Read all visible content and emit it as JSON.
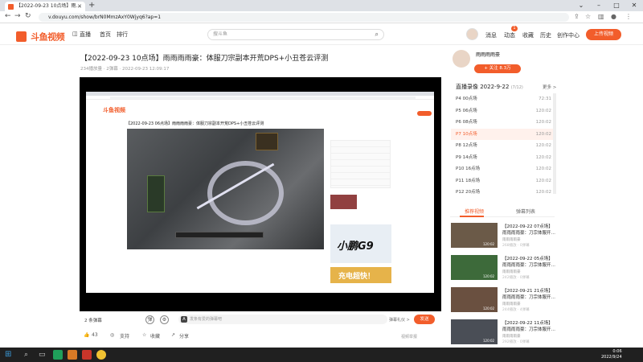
{
  "browser": {
    "tab_title": "【2022-09-23 10点场】雨…",
    "url": "v.douyu.com/show/brN0MmzAxY0Wjyq6?ap=1",
    "new_tab": "+"
  },
  "site": {
    "logo": "斗鱼视频",
    "nav": [
      "直播",
      "首页",
      "排行"
    ],
    "search_placeholder": "搜斗鱼",
    "user_links": [
      "消息",
      "动态",
      "收藏",
      "历史",
      "创作中心"
    ],
    "dynamic_badge": "1",
    "upload_label": "上传视频"
  },
  "video": {
    "title": "【2022-09-23 10点场】雨雨雨雨豪：体服刀宗副本开荒DPS+小丑苍云评测",
    "meta": "234播放量 · 2弹幕 · 2022-09-23 12:09:17",
    "danmu_count": "2 条弹幕",
    "danmu_placeholder": "发条有爱的弹幕吧",
    "danmu_settings": "弹幕礼仪 >",
    "send_label": "发送",
    "like_count": "43",
    "support_label": "支持",
    "collect_label": "收藏",
    "share_label": "分享",
    "report_label": "视频举报",
    "inner_logo": "斗鱼视频",
    "inner_title": "【2022-09-23 06点场】雨雨雨雨豪：体服刀宗副本开荒DPS+小丑苍云评测",
    "inner_ad_text": "小鹏G9",
    "inner_banner_text": "充电超快！"
  },
  "sidebar": {
    "author": "雨雨雨雨豪",
    "follow_label": "+ 关注 8.3万",
    "record_title": "直播录像 2022-9-22",
    "record_count": "7/12",
    "record_more": "更多 >",
    "records": [
      {
        "label": "P4 00点场",
        "dur": "72:31",
        "active": false
      },
      {
        "label": "P5 06点场",
        "dur": "120:02",
        "active": false
      },
      {
        "label": "P6 08点场",
        "dur": "120:02",
        "active": false
      },
      {
        "label": "P7 10点场",
        "dur": "120:02",
        "active": true
      },
      {
        "label": "P8 12点场",
        "dur": "120:02",
        "active": false
      },
      {
        "label": "P9 14点场",
        "dur": "120:02",
        "active": false
      },
      {
        "label": "P10 16点场",
        "dur": "120:02",
        "active": false
      },
      {
        "label": "P11 18点场",
        "dur": "120:02",
        "active": false
      },
      {
        "label": "P12 20点场",
        "dur": "120:02",
        "active": false
      }
    ],
    "tab_recommend": "推荐视频",
    "tab_danmu": "弹幕列表",
    "related": [
      {
        "title": "【2022-09-22 07点场】雨雨雨雨豪：刀宗体服开…",
        "author": "雨雨雨雨豪",
        "stats": "268播放 · 0弹幕",
        "dur": "120:02",
        "color": "#6b5a48"
      },
      {
        "title": "【2022-09-22 05点场】雨雨雨雨豪：刀宗体服开…",
        "author": "雨雨雨雨豪",
        "stats": "242播放 · 0弹幕",
        "dur": "120:02",
        "color": "#3d6a3a"
      },
      {
        "title": "【2022-09-21 21点场】雨雨雨雨豪：刀宗体服开…",
        "author": "雨雨雨雨豪",
        "stats": "244播放 · 4弹幕",
        "dur": "120:02",
        "color": "#6a5040"
      },
      {
        "title": "【2022-09-22 11点场】雨雨雨雨豪：刀宗体服开…",
        "author": "雨雨雨雨豪",
        "stats": "292播放 · 0弹幕",
        "dur": "120:02",
        "color": "#4a4e56"
      }
    ]
  },
  "taskbar": {
    "time": "0:06",
    "date": "2022/9/24"
  }
}
